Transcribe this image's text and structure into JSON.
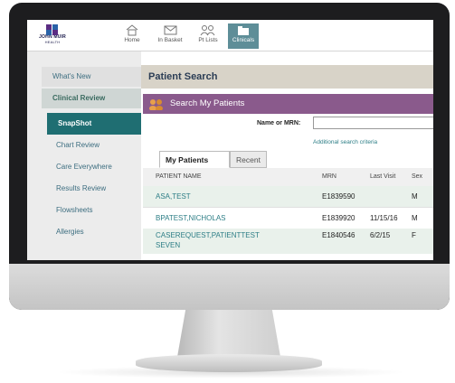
{
  "logo": {
    "line1": "JOHN MUIR",
    "line2": "HEALTH"
  },
  "nav": {
    "home": "Home",
    "in_basket": "In Basket",
    "pt_lists": "Pt Lists",
    "clinicals": "Clinicals"
  },
  "menu": {
    "whats_new": "What's New",
    "clinical_review": "Clinical Review",
    "snapshot": "SnapShot",
    "chart_review": "Chart Review",
    "care_everywhere": "Care Everywhere",
    "results_review": "Results Review",
    "flowsheets": "Flowsheets",
    "allergies": "Allergies"
  },
  "page": {
    "title": "Patient Search",
    "section_title": "Search My Patients",
    "name_label": "Name or MRN:",
    "name_value": "",
    "additional_link": "Additional search criteria"
  },
  "tabs": {
    "my_patients": "My Patients",
    "recent": "Recent"
  },
  "table": {
    "headers": {
      "name": "PATIENT NAME",
      "mrn": "MRN",
      "last_visit": "Last Visit",
      "sex": "Sex"
    },
    "rows": [
      {
        "name": "ASA,TEST",
        "mrn": "E1839590",
        "last_visit": "",
        "sex": "M"
      },
      {
        "name": "BPATEST,NICHOLAS",
        "mrn": "E1839920",
        "last_visit": "11/15/16",
        "sex": "M"
      },
      {
        "name_line1": "CASEREQUEST,PATIENTTEST",
        "name_line2": "SEVEN",
        "mrn": "E1840546",
        "last_visit": "6/2/15",
        "sex": "F"
      }
    ]
  },
  "colors": {
    "accent_teal": "#1f6e72",
    "purple_bar": "#8a5a8c",
    "link": "#2d7e86"
  }
}
